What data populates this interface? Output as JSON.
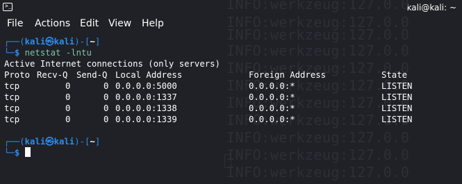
{
  "window": {
    "title": "kali@kali: ~",
    "icon": "terminal-icon",
    "icon_glyph": ">_"
  },
  "menu": [
    "File",
    "Actions",
    "Edit",
    "View",
    "Help"
  ],
  "watermark": {
    "lines": [
      "INFO:werkzeug:127.0.0",
      "INFO:werkzeug:127.0.0",
      "INFO:werkzeug:127.0.0",
      "INFO:werkzeug:127.0.0",
      "INFO:werkzeug:127.0.0",
      "INFO:werkzeug:127.0.0",
      "INFO:werkzeug:127.0.0",
      "INFO:werkzeug:127.0.0",
      "INFO:werkzeug:127.0.0",
      "INFO:werkzeug:127.0.0",
      "INFO:werkzeug:127.0.0"
    ]
  },
  "prompt": {
    "user": "kali",
    "at": "㉿",
    "host": "kali",
    "dir": "~",
    "symbol": "$"
  },
  "command": "netstat -lntu",
  "output": {
    "heading": "Active Internet connections (only servers)",
    "columns": [
      "Proto",
      "Recv-Q",
      "Send-Q",
      "Local Address",
      "Foreign Address",
      "State"
    ],
    "rows": [
      [
        "tcp",
        "0",
        "0",
        "0.0.0.0:5000",
        "0.0.0.0:*",
        "LISTEN"
      ],
      [
        "tcp",
        "0",
        "0",
        "0.0.0.0:1337",
        "0.0.0.0:*",
        "LISTEN"
      ],
      [
        "tcp",
        "0",
        "0",
        "0.0.0.0:1338",
        "0.0.0.0:*",
        "LISTEN"
      ],
      [
        "tcp",
        "0",
        "0",
        "0.0.0.0:1339",
        "0.0.0.0:*",
        "LISTEN"
      ]
    ]
  },
  "colors": {
    "background": "#1f2126",
    "prompt_blue": "#2e8cf0",
    "prompt_green": "#7cc4a4"
  }
}
